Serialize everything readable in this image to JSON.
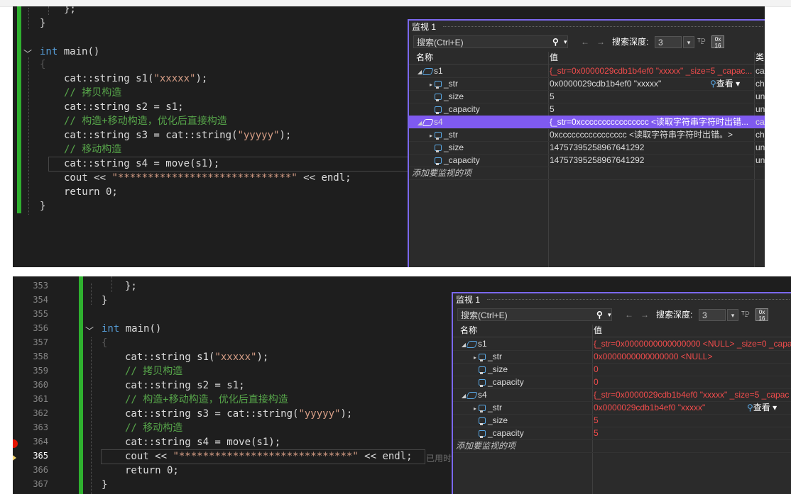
{
  "top_panel": {
    "code": {
      "closing_semicolon": "};",
      "closing_brace": "}",
      "main_kw": "int",
      "main_sig": " main()",
      "open_brace": "{",
      "lines": [
        {
          "pre": "cat::string s1(",
          "str": "\"xxxxx\"",
          "post": ");"
        },
        {
          "comment": "// 拷贝构造"
        },
        {
          "pre": "cat::string s2 = s1;"
        },
        {
          "comment": "// 构造+移动构造，优化后直接构造"
        },
        {
          "pre": "cat::string s3 = cat::string(",
          "str": "\"yyyyy\"",
          "post": ");"
        },
        {
          "comment": "// 移动构造"
        },
        {
          "pre": "cat::string s4 = move(s1);"
        },
        {
          "pre": "cout << ",
          "str": "\"*****************************\"",
          "post": " << endl;"
        },
        {
          "pre": "return 0;"
        }
      ],
      "end_brace": "}"
    },
    "watch": {
      "title": "监视 1",
      "search_placeholder": "搜索(Ctrl+E)",
      "search_icon_glyph": "⚲",
      "search_dd": "▾",
      "back_arrow": "←",
      "fwd_arrow": "→",
      "depth_label": "搜索深度:",
      "depth_value": "3",
      "depth_dd": "▾",
      "pin_glyph": "ᵀ𝙿",
      "hex_label": "0x\n16",
      "col_name": "名称",
      "col_value": "值",
      "col_type": "类",
      "rows": [
        {
          "name": "s1",
          "value": "{_str=0x0000029cdb1b4ef0 \"xxxxx\" _size=5 _capac...",
          "type": "ca",
          "color": "red"
        },
        {
          "name": "_str",
          "value": "0x0000029cdb1b4ef0 \"xxxxx\"",
          "type": "ch",
          "color": "valw",
          "viewer": "查看 ▾"
        },
        {
          "name": "_size",
          "value": "5",
          "type": "un",
          "color": "valw"
        },
        {
          "name": "_capacity",
          "value": "5",
          "type": "un",
          "color": "valw"
        },
        {
          "name": "s4",
          "value": "{_str=0xcccccccccccccccc <读取字符串字符时出错...",
          "type": "ca",
          "color": "white"
        },
        {
          "name": "_str",
          "value": "0xcccccccccccccccc <读取字符串字符时出错。>",
          "type": "ch",
          "color": "valw"
        },
        {
          "name": "_size",
          "value": "14757395258967641292",
          "type": "un",
          "color": "valw"
        },
        {
          "name": "_capacity",
          "value": "14757395258967641292",
          "type": "un",
          "color": "valw"
        }
      ],
      "add_item": "添加要监视的项"
    }
  },
  "bottom_panel": {
    "line_numbers": [
      "353",
      "354",
      "355",
      "356",
      "357",
      "358",
      "359",
      "360",
      "361",
      "362",
      "363",
      "364",
      "365",
      "366",
      "367"
    ],
    "current_line": "365",
    "code": {
      "closing_semicolon": "};",
      "closing_brace": "}",
      "main_kw": "int",
      "main_sig": " main()",
      "open_brace": "{",
      "lines": [
        {
          "pre": "cat::string s1(",
          "str": "\"xxxxx\"",
          "post": ");"
        },
        {
          "comment": "// 拷贝构造"
        },
        {
          "pre": "cat::string s2 = s1;"
        },
        {
          "comment": "// 构造+移动构造，优化后直接构造"
        },
        {
          "pre": "cat::string s3 = cat::string(",
          "str": "\"yyyyy\"",
          "post": ");"
        },
        {
          "comment": "// 移动构造"
        },
        {
          "pre": "cat::string s4 = move(s1);"
        },
        {
          "pre": "cout << ",
          "str": "\"*****************************\"",
          "post": " << endl;"
        },
        {
          "pre": "return 0;"
        }
      ],
      "end_brace": "}",
      "elapsed_hint": "已用时"
    },
    "watch": {
      "title": "监视 1",
      "search_placeholder": "搜索(Ctrl+E)",
      "search_icon_glyph": "⚲",
      "search_dd": "▾",
      "back_arrow": "←",
      "fwd_arrow": "→",
      "depth_label": "搜索深度:",
      "depth_value": "3",
      "depth_dd": "▾",
      "pin_glyph": "ᵀ𝙿",
      "hex_label": "0x\n16",
      "col_name": "名称",
      "col_value": "值",
      "rows": [
        {
          "name": "s1",
          "value": "{_str=0x0000000000000000 <NULL> _size=0 _capac",
          "color": "red"
        },
        {
          "name": "_str",
          "value": "0x0000000000000000 <NULL>",
          "color": "red"
        },
        {
          "name": "_size",
          "value": "0",
          "color": "red"
        },
        {
          "name": "_capacity",
          "value": "0",
          "color": "red"
        },
        {
          "name": "s4",
          "value": "{_str=0x0000029cdb1b4ef0 \"xxxxx\" _size=5 _capac",
          "color": "red"
        },
        {
          "name": "_str",
          "value": "0x0000029cdb1b4ef0 \"xxxxx\"",
          "color": "red",
          "viewer": "查看 ▾"
        },
        {
          "name": "_size",
          "value": "5",
          "color": "red"
        },
        {
          "name": "_capacity",
          "value": "5",
          "color": "red"
        }
      ],
      "add_item": "添加要监视的项"
    }
  },
  "colors": {
    "editor_bg": "#1e1e1e",
    "keyword": "#569cd6",
    "string": "#d69d85",
    "comment": "#57a64a",
    "changed_value": "#f14c4c",
    "selection": "#7f5af0",
    "watch_border": "#7b68ee",
    "gutter_green": "#2fb12f"
  }
}
